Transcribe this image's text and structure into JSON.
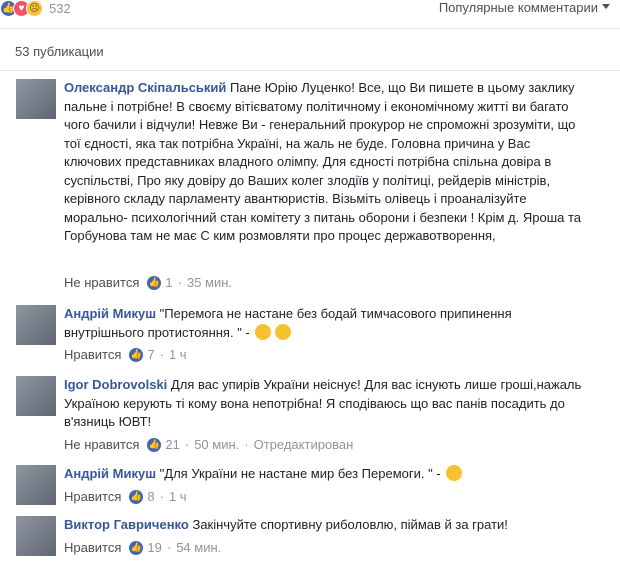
{
  "reactions": {
    "icons": [
      "like-icon",
      "love-icon",
      "angry-icon"
    ],
    "count": "532",
    "colors": {
      "like": "#4267b2",
      "love": "#f25268",
      "angry": "#f5c33b"
    }
  },
  "sort_label": "Популярные комментарии",
  "publications_count": "53 публикации",
  "comments": [
    {
      "author": "Олександр Скіпальський",
      "text": "Пане Юрію Луценко! Все, що Ви пишете в цьому заклику пальне і потрібне! В своєму вітієватому політичному і економічному житті ви багато чого бачили і відчули! Невже Ви - генеральний прокурор не спроможні зрозуміти, що тої єдності, яка так потрібна Україні, на жаль не буде. Головна причина у Вас ключових представниках владного олімпу. Для єдності потрібна спільна довіра в суспільстві, Про яку довіру до Ваших колег злодіїв у політиці, рейдерів міністрів, керівного складу парламенту авантюристів. Візьміть олівець і проаналізуйте морально- психологічний стан комітету з питань оборони і безпеки ! Крім д. Яроша та Горбунова там не має С ким розмовляти про процес державотворення,",
      "like_label": "Не нравится",
      "likes": "1",
      "time": "35 мин.",
      "edited": ""
    },
    {
      "author": "Андрій Микуш",
      "text": "\"Перемога не настане без бодай тимчасового припинення внутрішнього протистояння. \" -",
      "like_label": "Нравится",
      "likes": "7",
      "time": "1 ч",
      "edited": ""
    },
    {
      "author": "Igor Dobrovolski",
      "text": "Для вас упирів України неіснує! Для вас існують лише гроші,нажаль Україною керують ті кому вона непотрібна! Я сподіваюсь що вас панів посадить до в'язниць ЮВТ!",
      "like_label": "Не нравится",
      "likes": "21",
      "time": "50 мин.",
      "edited": "Отредактирован"
    },
    {
      "author": "Андрій Микуш",
      "text": "\"Для України не настане мир без Перемоги. \" -",
      "like_label": "Нравится",
      "likes": "8",
      "time": "1 ч",
      "edited": ""
    },
    {
      "author": "Виктор Гавриченко",
      "text": "Закінчуйте спортивну риболовлю, піймав й за грати!",
      "like_label": "Нравится",
      "likes": "19",
      "time": "54 мин.",
      "edited": ""
    }
  ]
}
